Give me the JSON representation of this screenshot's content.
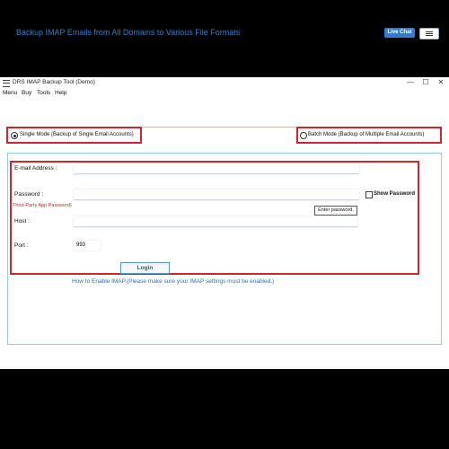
{
  "window": {
    "title": "DRS IMAP Backup Tool (Demo)",
    "minimize_glyph": "—",
    "maximize_glyph": "☐",
    "close_glyph": "✕"
  },
  "menubar": {
    "items": [
      "Menu",
      "Buy",
      "Tools",
      "Help"
    ]
  },
  "header": {
    "heading": "Backup IMAP Emails from All Domains to Various File Formats",
    "live_chat": "Live Chat",
    "menu_icon": "hamburger-icon"
  },
  "modes": {
    "single": "Single Mode (Backup of Single Email Accounts)",
    "batch": "Batch Mode (Backup of Multiple Email Accounts)",
    "selected": "single"
  },
  "form": {
    "email_label": "E-mail Address :",
    "email_value": "",
    "password_label": "Password :",
    "password_value": "",
    "third_party_hint": "Third-Party App Password)",
    "show_password_label": "Show Password",
    "show_password_checked": false,
    "enter_password_tooltip": "Enter password.",
    "host_label": "Host :",
    "host_value": "",
    "port_label": "Port :",
    "port_value": "993",
    "login_button": "Login",
    "how_to_link": "How to Enable IMAP.(Please make sure your IMAP settings must be enabled.)"
  },
  "colors": {
    "accent": "#2d7ec4",
    "highlight_border": "#d2232f",
    "live_chat_bg": "#2f7dd6"
  }
}
